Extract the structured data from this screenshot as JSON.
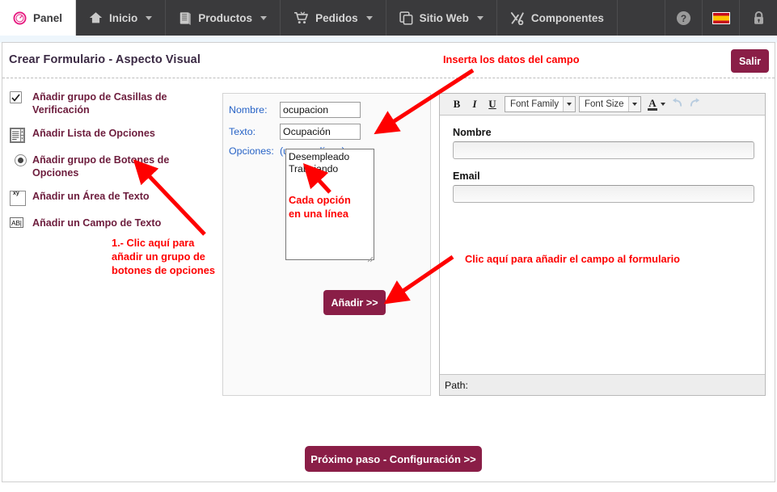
{
  "topnav": {
    "items": [
      {
        "label": "Panel",
        "icon": "gauge-icon",
        "caret": false,
        "active": true
      },
      {
        "label": "Inicio",
        "icon": "home-icon",
        "caret": true,
        "active": false
      },
      {
        "label": "Productos",
        "icon": "boxes-icon",
        "caret": true,
        "active": false
      },
      {
        "label": "Pedidos",
        "icon": "cart-icon",
        "caret": true,
        "active": false
      },
      {
        "label": "Sitio Web",
        "icon": "copy-icon",
        "caret": true,
        "active": false
      },
      {
        "label": "Componentes",
        "icon": "tools-icon",
        "caret": false,
        "active": false
      }
    ],
    "right_icons": [
      {
        "name": "help-icon"
      },
      {
        "name": "spanish-flag-icon"
      },
      {
        "name": "lock-icon"
      }
    ],
    "bar_color": "#3a3a3c",
    "active_bg": "#ffffff",
    "accent_color": "#e6197f"
  },
  "header": {
    "title": "Crear Formulario - Aspecto Visual",
    "exit_label": "Salir",
    "brand_color": "#8a1e47"
  },
  "field_types": {
    "items": [
      {
        "label": "Añadir grupo de Casillas de Verificación",
        "icon": "checkbox-icon"
      },
      {
        "label": "Añadir Lista de Opciones",
        "icon": "list-icon"
      },
      {
        "label": "Añadir grupo de Botones de Opciones",
        "icon": "radio-button-icon"
      },
      {
        "label": "Añadir un Área de Texto",
        "icon": "textarea-icon"
      },
      {
        "label": "Añadir un Campo de Texto",
        "icon": "textfield-icon"
      }
    ],
    "label_color": "#6d1d3d"
  },
  "field_form": {
    "name_label": "Nombre:",
    "name_value": "ocupacion",
    "text_label": "Texto:",
    "text_value": "Ocupación",
    "options_label": "Opciones:",
    "options_hint": "(una por línea)",
    "options_value": "Desempleado\nTrabajando",
    "add_button": "Añadir >>",
    "label_color": "#2763c6"
  },
  "editor": {
    "toolbar": {
      "bold": "B",
      "italic": "I",
      "underline": "U",
      "font_family_label": "Font Family",
      "font_size_label": "Font Size",
      "forecolor_label": "A",
      "undo_icon": "undo-icon",
      "redo_icon": "redo-icon"
    },
    "fields": [
      {
        "label": "Nombre",
        "value": ""
      },
      {
        "label": "Email",
        "value": ""
      }
    ],
    "status_label": "Path:"
  },
  "footer": {
    "next_label": "Próximo paso - Configuración >>"
  },
  "annotations": {
    "color": "#fe0000",
    "items": [
      {
        "id": "insert-field-data",
        "text": "Inserta los datos del campo"
      },
      {
        "id": "click-radio-group",
        "text": "1.- Clic aquí para\nañadir un grupo de\nbotones de opciones"
      },
      {
        "id": "one-option-per-line",
        "text": "Cada opción\nen una línea"
      },
      {
        "id": "click-add-field",
        "text": "Clic aquí para añadir el campo al formulario"
      }
    ]
  }
}
